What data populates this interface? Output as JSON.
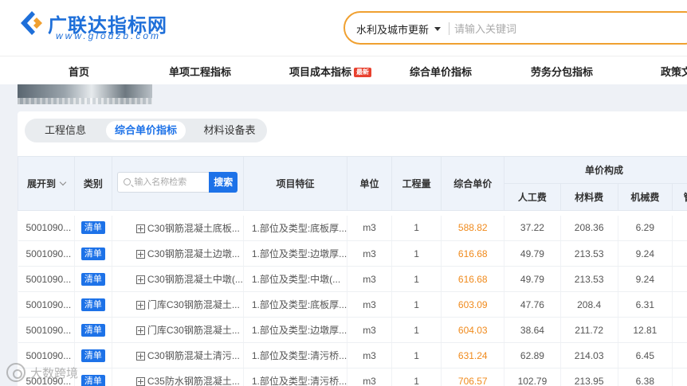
{
  "brand": {
    "title": "广联达指标网",
    "subtitle": "www.glodzb.com",
    "color": "#1e6fd9"
  },
  "search": {
    "category": "水利及城市更新",
    "placeholder": "请输入关键词"
  },
  "nav": {
    "items": [
      {
        "label": "首页"
      },
      {
        "label": "单项工程指标"
      },
      {
        "label": "项目成本指标",
        "badge": "最新"
      },
      {
        "label": "综合单价指标"
      },
      {
        "label": "劳务分包指标"
      },
      {
        "label": "政策文"
      }
    ]
  },
  "tabs": [
    {
      "label": "工程信息",
      "active": false
    },
    {
      "label": "综合单价指标",
      "active": true
    },
    {
      "label": "材料设备表",
      "active": false
    }
  ],
  "table": {
    "headers": {
      "expand_to": "展开到",
      "category": "类别",
      "name_search_placeholder": "输入名称检索",
      "name_search_button": "搜索",
      "feature": "项目特征",
      "unit": "单位",
      "quantity": "工程量",
      "unit_price": "综合单价",
      "price_composition": "单价构成",
      "labor": "人工费",
      "material": "材料费",
      "machinery": "机械费",
      "management": "管"
    },
    "rows": [
      {
        "code": "5001090...",
        "category": "清单",
        "name": "C30钢筋混凝土底板...",
        "feature": "1.部位及类型:底板厚...",
        "unit": "m3",
        "quantity": "1",
        "price": "588.82",
        "labor": "37.22",
        "material": "208.36",
        "machinery": "6.29"
      },
      {
        "code": "5001090...",
        "category": "清单",
        "name": "C30钢筋混凝土边墩...",
        "feature": "1.部位及类型:边墩厚...",
        "unit": "m3",
        "quantity": "1",
        "price": "616.68",
        "labor": "49.79",
        "material": "213.53",
        "machinery": "9.24"
      },
      {
        "code": "5001090...",
        "category": "清单",
        "name": "C30钢筋混凝土中墩(...",
        "feature": "1.部位及类型:中墩(...",
        "unit": "m3",
        "quantity": "1",
        "price": "616.68",
        "labor": "49.79",
        "material": "213.53",
        "machinery": "9.24"
      },
      {
        "code": "5001090...",
        "category": "清单",
        "name": "门库C30钢筋混凝土...",
        "feature": "1.部位及类型:底板厚...",
        "unit": "m3",
        "quantity": "1",
        "price": "603.09",
        "labor": "47.76",
        "material": "208.4",
        "machinery": "6.31"
      },
      {
        "code": "5001090...",
        "category": "清单",
        "name": "门库C30钢筋混凝土...",
        "feature": "1.部位及类型:边墩厚...",
        "unit": "m3",
        "quantity": "1",
        "price": "604.03",
        "labor": "38.64",
        "material": "211.72",
        "machinery": "12.81"
      },
      {
        "code": "5001090...",
        "category": "清单",
        "name": "C30钢筋混凝土清污...",
        "feature": "1.部位及类型:清污桥...",
        "unit": "m3",
        "quantity": "1",
        "price": "631.24",
        "labor": "62.89",
        "material": "214.03",
        "machinery": "6.45"
      },
      {
        "code": "5001090...",
        "category": "清单",
        "name": "C35防水钢筋混凝土...",
        "feature": "1.部位及类型:清污桥...",
        "unit": "m3",
        "quantity": "1",
        "price": "706.57",
        "labor": "102.79",
        "material": "213.95",
        "machinery": "6.38"
      }
    ]
  },
  "watermark": {
    "text": "大数跨境"
  },
  "colors": {
    "accent": "#1d72e8",
    "price": "#f08a1c",
    "search_border": "#f0a030",
    "badge_new": "#e8412f"
  }
}
